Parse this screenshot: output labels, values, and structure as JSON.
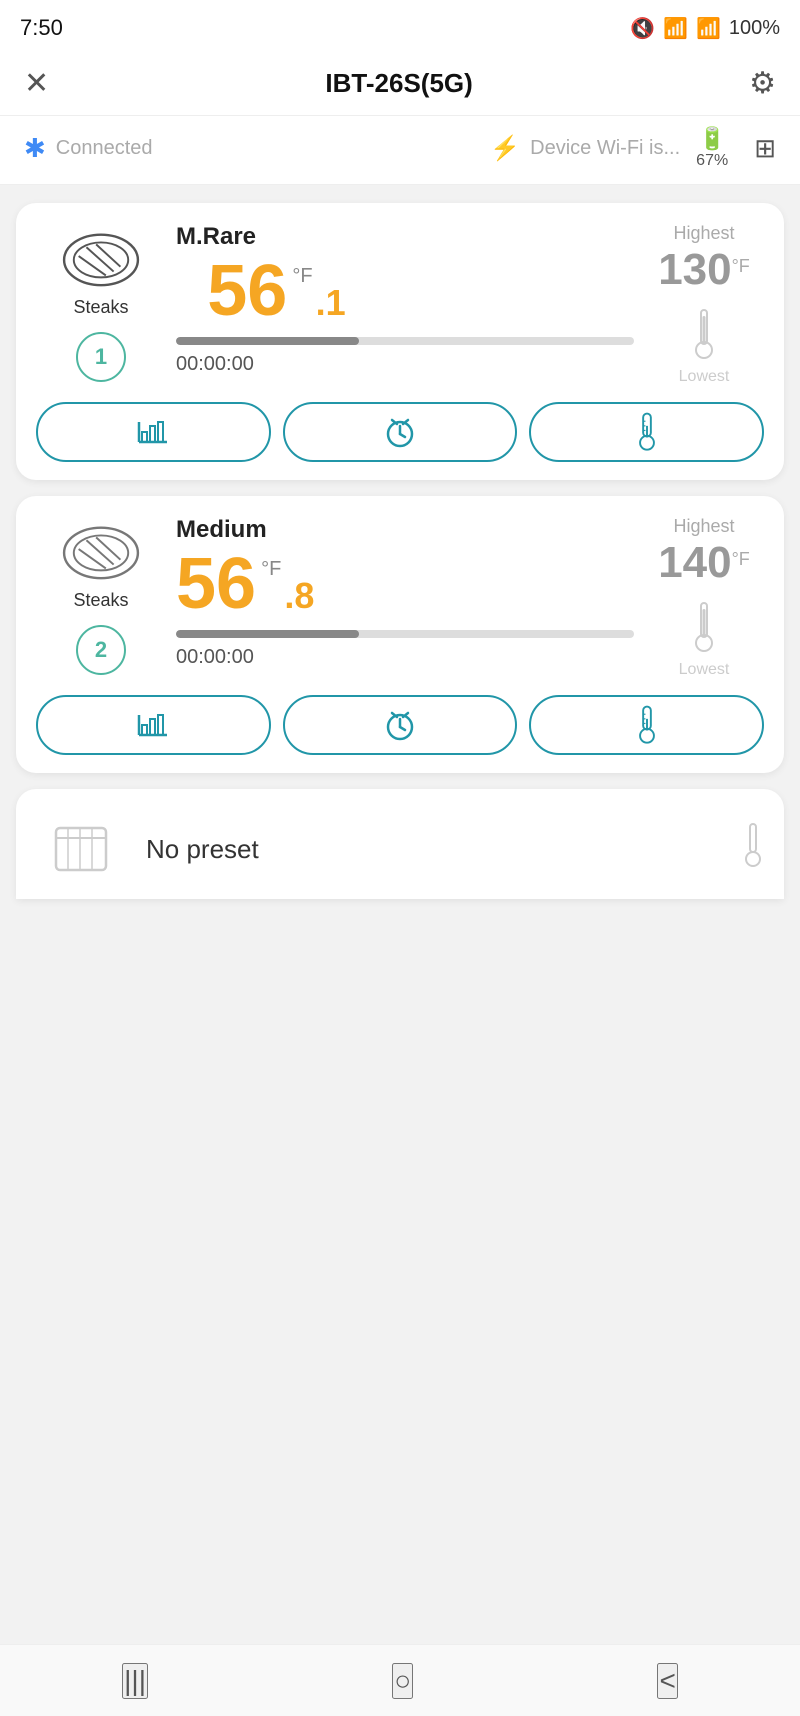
{
  "statusBar": {
    "time": "7:50",
    "battery": "100%"
  },
  "header": {
    "title": "IBT-26S(5G)",
    "closeIcon": "✕",
    "settingsIcon": "⚙"
  },
  "connectionBar": {
    "bluetoothText": "Connected",
    "wifiText": "Device Wi-Fi is...",
    "batteryPercent": "67%"
  },
  "probes": [
    {
      "id": 1,
      "presetName": "M.Rare",
      "foodType": "Steaks",
      "tempWhole": "56",
      "tempDec": ".1",
      "tempUnit": "°F",
      "highest": "130",
      "highestUnit": "°F",
      "timer": "00:00:00",
      "progressPct": 40
    },
    {
      "id": 2,
      "presetName": "Medium",
      "foodType": "Steaks",
      "tempWhole": "56",
      "tempDec": ".8",
      "tempUnit": "°F",
      "highest": "140",
      "highestUnit": "°F",
      "timer": "00:00:00",
      "progressPct": 40
    }
  ],
  "noPreset": {
    "text": "No preset"
  },
  "buttons": {
    "graphLabel": "graph",
    "alarmLabel": "alarm",
    "tempLabel": "temperature"
  },
  "bottomNav": {
    "backIcon": "|||",
    "homeIcon": "○",
    "prevIcon": "<"
  }
}
